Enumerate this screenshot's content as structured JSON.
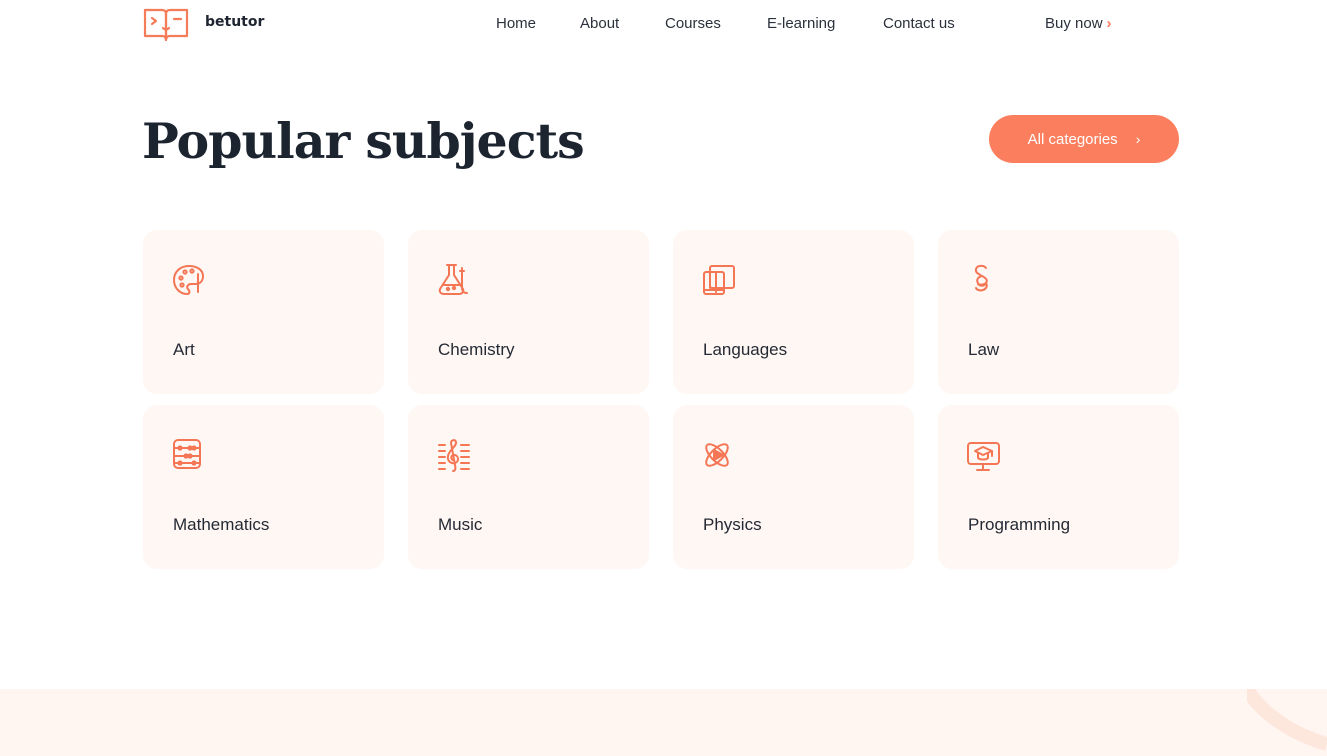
{
  "header": {
    "brand": "betutor",
    "nav": [
      {
        "label": "Home"
      },
      {
        "label": "About"
      },
      {
        "label": "Courses"
      },
      {
        "label": "E-learning"
      },
      {
        "label": "Contact us"
      }
    ],
    "buy_label": "Buy now",
    "buy_icon": "chevron-right-icon"
  },
  "main": {
    "title": "Popular subjects",
    "all_categories_label": "All categories",
    "subjects": [
      {
        "label": "Art",
        "icon": "palette-icon"
      },
      {
        "label": "Chemistry",
        "icon": "flask-icon"
      },
      {
        "label": "Languages",
        "icon": "books-icon"
      },
      {
        "label": "Law",
        "icon": "section-sign-icon"
      },
      {
        "label": "Mathematics",
        "icon": "abacus-icon"
      },
      {
        "label": "Music",
        "icon": "treble-clef-icon"
      },
      {
        "label": "Physics",
        "icon": "atom-icon"
      },
      {
        "label": "Programming",
        "icon": "monitor-graduation-icon"
      }
    ]
  },
  "colors": {
    "accent": "#fb7f5e",
    "card_bg": "#fff7f3",
    "text": "#1f2530"
  }
}
